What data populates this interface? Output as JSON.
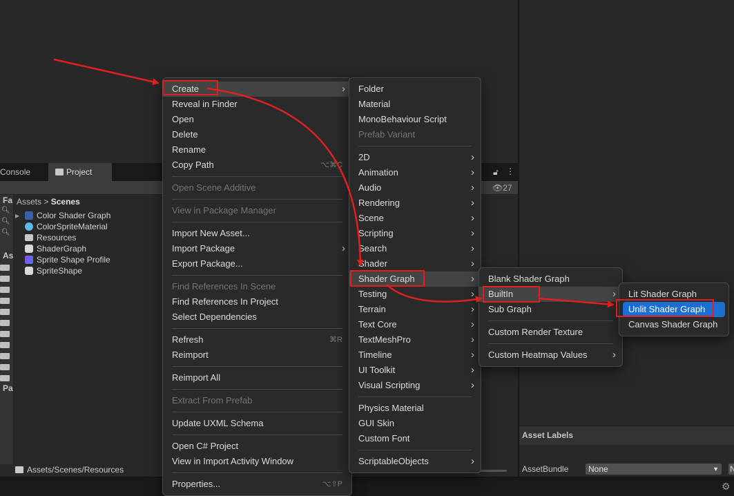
{
  "project": {
    "tabs": [
      {
        "label": "Console"
      },
      {
        "label": "Project"
      }
    ],
    "breadcrumb": {
      "root": "Assets",
      "sep": ">",
      "current": "Scenes"
    },
    "hidden_count": "27",
    "left_pane_labels": [
      "Fa",
      "As",
      "Pa"
    ],
    "assets": [
      {
        "label": "Color Shader Graph",
        "icon": "shader-graph-icon"
      },
      {
        "label": "ColorSpriteMaterial",
        "icon": "material-icon"
      },
      {
        "label": "Resources",
        "icon": "folder-icon"
      },
      {
        "label": "ShaderGraph",
        "icon": "unity-package-icon"
      },
      {
        "label": "Sprite Shape Profile",
        "icon": "sprite-shape-profile-icon"
      },
      {
        "label": "SpriteShape",
        "icon": "unity-package-icon"
      }
    ],
    "bottom_path": "Assets/Scenes/Resources"
  },
  "inspector": {
    "asset_labels_title": "Asset Labels",
    "assetbundle_label": "AssetBundle",
    "assetbundle_value": "None",
    "assetbundle_variant": "N"
  },
  "menus": {
    "context": [
      {
        "label": "Create",
        "submenu": true,
        "highlight": true
      },
      {
        "label": "Reveal in Finder"
      },
      {
        "label": "Open"
      },
      {
        "label": "Delete"
      },
      {
        "label": "Rename"
      },
      {
        "label": "Copy Path",
        "shortcut": "⌥⌘C"
      },
      {
        "sep": true
      },
      {
        "label": "Open Scene Additive",
        "disabled": true
      },
      {
        "sep": true
      },
      {
        "label": "View in Package Manager",
        "disabled": true
      },
      {
        "sep": true
      },
      {
        "label": "Import New Asset..."
      },
      {
        "label": "Import Package",
        "submenu": true
      },
      {
        "label": "Export Package..."
      },
      {
        "sep": true
      },
      {
        "label": "Find References In Scene",
        "disabled": true
      },
      {
        "label": "Find References In Project"
      },
      {
        "label": "Select Dependencies"
      },
      {
        "sep": true
      },
      {
        "label": "Refresh",
        "shortcut": "⌘R"
      },
      {
        "label": "Reimport"
      },
      {
        "sep": true
      },
      {
        "label": "Reimport All"
      },
      {
        "sep": true
      },
      {
        "label": "Extract From Prefab",
        "disabled": true
      },
      {
        "sep": true
      },
      {
        "label": "Update UXML Schema"
      },
      {
        "sep": true
      },
      {
        "label": "Open C# Project"
      },
      {
        "label": "View in Import Activity Window"
      },
      {
        "sep": true
      },
      {
        "label": "Properties...",
        "shortcut": "⌥⇧P"
      }
    ],
    "create": [
      {
        "label": "Folder"
      },
      {
        "label": "Material"
      },
      {
        "label": "MonoBehaviour Script"
      },
      {
        "label": "Prefab Variant",
        "disabled": true
      },
      {
        "sep": true
      },
      {
        "label": "2D",
        "submenu": true
      },
      {
        "label": "Animation",
        "submenu": true
      },
      {
        "label": "Audio",
        "submenu": true
      },
      {
        "label": "Rendering",
        "submenu": true
      },
      {
        "label": "Scene",
        "submenu": true
      },
      {
        "label": "Scripting",
        "submenu": true
      },
      {
        "label": "Search",
        "submenu": true
      },
      {
        "label": "Shader",
        "submenu": true
      },
      {
        "label": "Shader Graph",
        "submenu": true,
        "highlight": true
      },
      {
        "label": "Testing",
        "submenu": true
      },
      {
        "label": "Terrain",
        "submenu": true
      },
      {
        "label": "Text Core",
        "submenu": true
      },
      {
        "label": "TextMeshPro",
        "submenu": true
      },
      {
        "label": "Timeline",
        "submenu": true
      },
      {
        "label": "UI Toolkit",
        "submenu": true
      },
      {
        "label": "Visual Scripting",
        "submenu": true
      },
      {
        "sep": true
      },
      {
        "label": "Physics Material"
      },
      {
        "label": "GUI Skin"
      },
      {
        "label": "Custom Font"
      },
      {
        "sep": true
      },
      {
        "label": "ScriptableObjects",
        "submenu": true
      }
    ],
    "shader_graph": [
      {
        "label": "Blank Shader Graph"
      },
      {
        "label": "BuiltIn",
        "submenu": true,
        "highlight": true
      },
      {
        "label": "Sub Graph"
      },
      {
        "sep": true
      },
      {
        "label": "Custom Render Texture"
      },
      {
        "sep": true
      },
      {
        "label": "Custom Heatmap Values",
        "submenu": true
      }
    ],
    "builtin": [
      {
        "label": "Lit Shader Graph"
      },
      {
        "label": "Unlit Shader Graph",
        "selected": true
      },
      {
        "label": "Canvas Shader Graph"
      }
    ]
  },
  "colors": {
    "menu_bg": "#2a2a2a",
    "selection": "#1c6fd2",
    "annotation": "#e02020"
  }
}
